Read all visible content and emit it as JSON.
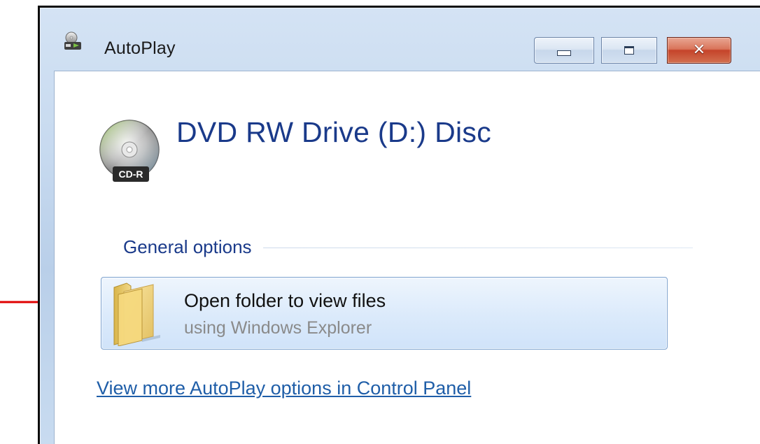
{
  "window": {
    "title": "AutoPlay"
  },
  "title_buttons": {
    "minimize_icon": "minimize-icon",
    "restore_icon": "restore-icon",
    "close_icon": "close-icon",
    "close_glyph": "✕"
  },
  "device": {
    "title": "DVD RW Drive (D:) Disc",
    "badge": "CD-R",
    "icon": "cd-r-disc-icon"
  },
  "general_options": {
    "header": "General options",
    "items": [
      {
        "title": "Open folder to view files",
        "subtitle": "using Windows Explorer",
        "icon": "folder-icon"
      }
    ]
  },
  "footer": {
    "control_panel_link": "View more AutoPlay options in Control Panel"
  },
  "colors": {
    "heading_blue": "#1a3a8a",
    "link_blue": "#1f5ea8",
    "annotation_red": "#e00000",
    "close_red": "#c5432a"
  }
}
